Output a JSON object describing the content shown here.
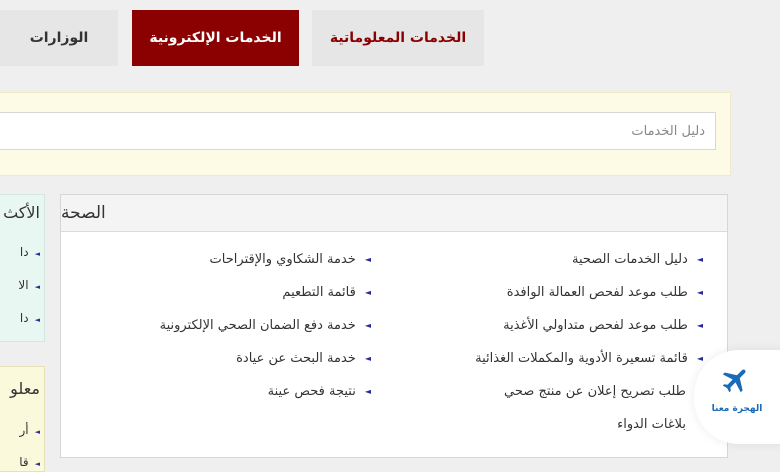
{
  "tabs": {
    "ministries": "الوزارات",
    "eservices": "الخدمات الإلكترونية",
    "info": "الخدمات المعلوماتية"
  },
  "search": {
    "placeholder": "دليل الخدمات"
  },
  "panel": {
    "title": "الصحة",
    "right_column": [
      "دليل الخدمات الصحية",
      "طلب موعد لفحص العمالة الوافدة",
      "طلب موعد لفحص متداولي الأغذية",
      "قائمة تسعيرة الأدوية والمكملات الغذائية"
    ],
    "right_extra": [
      "طلب تصريح إعلان عن منتج صحي",
      "بلاغات الدواء"
    ],
    "left_column": [
      "خدمة الشكاوي والإقتراحات",
      "قائمة التطعيم",
      "خدمة دفع الضمان الصحي الإلكترونية",
      "خدمة البحث عن عيادة",
      "نتيجة فحص عينة"
    ]
  },
  "sidebar": {
    "box1_title": "الأكث",
    "box1_items": [
      "دا",
      "الا",
      "دا"
    ],
    "box2_title": "معلو",
    "box2_items": [
      "أر",
      "قا"
    ]
  },
  "badge": {
    "text": "الهجرة معنا",
    "icon": "airplane-icon"
  },
  "colors": {
    "active_tab": "#8b0000",
    "accent_text": "#8b0000",
    "bullet": "#2a2a9a",
    "badge_text": "#1a6bb5"
  }
}
